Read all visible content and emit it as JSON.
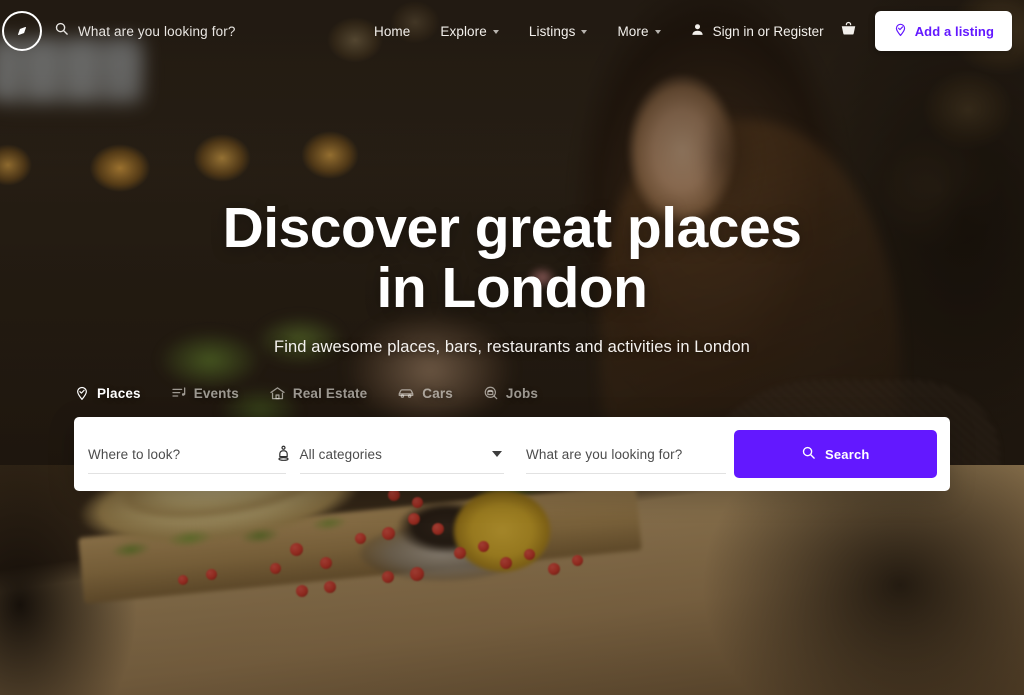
{
  "brand": {
    "logo_icon": "compass-icon"
  },
  "topnav": {
    "search_placeholder": "What are you looking for?",
    "search_icon": "search-icon",
    "links": [
      {
        "label": "Home",
        "has_caret": false
      },
      {
        "label": "Explore",
        "has_caret": true
      },
      {
        "label": "Listings",
        "has_caret": true
      },
      {
        "label": "More",
        "has_caret": true
      }
    ],
    "account_label": "Sign in or Register",
    "account_icon": "user-icon",
    "cart_icon": "basket-icon",
    "add_listing_label": "Add a listing",
    "add_listing_icon": "map-pin-check-icon"
  },
  "hero": {
    "title_line1": "Discover great places",
    "title_line2": "in London",
    "subtitle": "Find awesome places, bars, restaurants and activities in London"
  },
  "tabs": [
    {
      "label": "Places",
      "icon": "map-pin-check-icon",
      "active": true
    },
    {
      "label": "Events",
      "icon": "event-list-icon",
      "active": false
    },
    {
      "label": "Real Estate",
      "icon": "house-icon",
      "active": false
    },
    {
      "label": "Cars",
      "icon": "car-icon",
      "active": false
    },
    {
      "label": "Jobs",
      "icon": "briefcase-search-icon",
      "active": false
    }
  ],
  "search": {
    "location_placeholder": "Where to look?",
    "location_value": "",
    "locate_icon": "locate-me-icon",
    "category_selected": "All categories",
    "category_caret_icon": "chevron-down-icon",
    "keyword_placeholder": "What are you looking for?",
    "keyword_value": "",
    "button_label": "Search",
    "button_icon": "search-icon"
  },
  "colors": {
    "accent": "#6318ff",
    "card_bg": "#ffffff",
    "text_light": "#ffffff"
  }
}
